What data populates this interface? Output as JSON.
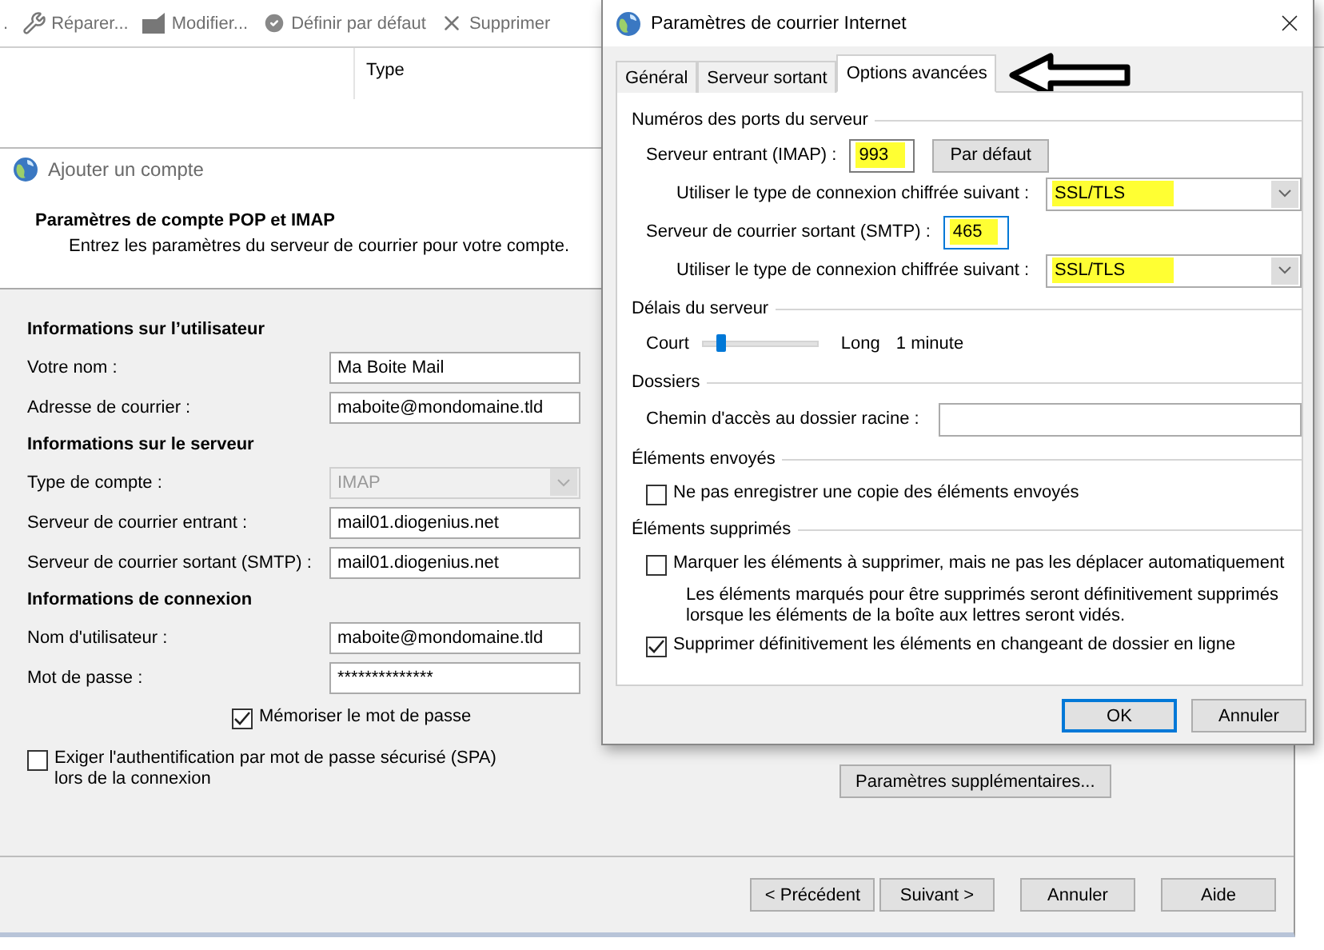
{
  "background_window": {
    "toolbar": [
      {
        "kind": "fragment",
        "label": ".",
        "disabled": true
      },
      {
        "kind": "repair",
        "label": "Réparer...",
        "disabled": true
      },
      {
        "kind": "modify",
        "label": "Modifier...",
        "disabled": true
      },
      {
        "kind": "set_default",
        "label": "Définir par défaut",
        "disabled": true
      },
      {
        "kind": "delete",
        "label": "Supprimer",
        "disabled": true
      }
    ],
    "list_columns": [
      "Type"
    ]
  },
  "add_account": {
    "title": "Ajouter un compte",
    "heading": "Paramètres de compte POP et IMAP",
    "subtitle": "Entrez les paramètres du serveur de courrier pour votre compte.",
    "sections": [
      {
        "title": "Informations sur l’utilisateur",
        "fields": [
          {
            "kind": "text",
            "label": "Votre nom :",
            "value": "Ma Boite Mail",
            "disabled": false
          },
          {
            "kind": "text",
            "label": "Adresse de courrier :",
            "value": "maboite@mondomaine.tld",
            "disabled": false
          }
        ]
      },
      {
        "title": "Informations sur le serveur",
        "fields": [
          {
            "kind": "select",
            "label": "Type de compte :",
            "value": "IMAP",
            "disabled": true
          },
          {
            "kind": "text",
            "label": "Serveur de courrier entrant :",
            "value": "mail01.diogenius.net",
            "disabled": false
          },
          {
            "kind": "text",
            "label": "Serveur de courrier sortant (SMTP) :",
            "value": "mail01.diogenius.net",
            "disabled": false
          }
        ]
      },
      {
        "title": "Informations de connexion",
        "fields": [
          {
            "kind": "text",
            "label": "Nom d'utilisateur :",
            "value": "maboite@mondomaine.tld",
            "disabled": false
          },
          {
            "kind": "text",
            "label": "Mot de passe :",
            "value": "**************",
            "disabled": false
          }
        ]
      }
    ],
    "remember_password": {
      "label": "Mémoriser le mot de passe",
      "checked": true
    },
    "spa": {
      "label_lines": [
        "Exiger l'authentification par mot de passe sécurisé (SPA)",
        "lors de la connexion"
      ],
      "checked": false
    },
    "more_settings_button": "Paramètres supplémentaires...",
    "footer_buttons": [
      "< Précédent",
      "Suivant >",
      "Annuler",
      "Aide"
    ]
  },
  "internet_settings": {
    "title": "Paramètres de courrier Internet",
    "tabs": [
      {
        "label": "Général",
        "selected": false
      },
      {
        "label": "Serveur sortant",
        "selected": false
      },
      {
        "label": "Options avancées",
        "selected": true
      }
    ],
    "groups": [
      {
        "title": "Numéros des ports du serveur",
        "items": [
          {
            "kind": "port",
            "label": "Serveur entrant (IMAP) :",
            "value": "993",
            "highlighted": true,
            "focused": false,
            "button": "Par défaut"
          },
          {
            "kind": "select",
            "label": "Utiliser le type de connexion chiffrée suivant :",
            "value": "SSL/TLS",
            "highlighted": true
          },
          {
            "kind": "port",
            "label": "Serveur de courrier sortant (SMTP) :",
            "value": "465",
            "highlighted": true,
            "focused": true
          },
          {
            "kind": "select",
            "label": "Utiliser le type de connexion chiffrée suivant :",
            "value": "SSL/TLS",
            "highlighted": true
          }
        ]
      },
      {
        "title": "Délais du serveur",
        "items": [
          {
            "kind": "slider",
            "min_label": "Court",
            "max_label": "Long",
            "level": 0.12,
            "reading": "1 minute"
          }
        ]
      },
      {
        "title": "Dossiers",
        "items": [
          {
            "kind": "text_field",
            "label": "Chemin d'accès au dossier racine :"
          }
        ]
      },
      {
        "title": "Éléments envoyés",
        "items": [
          {
            "kind": "checkbox",
            "label": "Ne pas enregistrer une copie des éléments envoyés",
            "checked": false
          }
        ]
      },
      {
        "title": "Éléments supprimés",
        "items": [
          {
            "kind": "checkbox",
            "label": "Marquer les éléments à supprimer, mais ne pas les déplacer automatiquement",
            "checked": false
          },
          {
            "kind": "note",
            "lines": [
              "Les éléments marqués pour être supprimés seront définitivement supprimés",
              "lorsque les éléments de la boîte aux lettres seront vidés."
            ]
          },
          {
            "kind": "checkbox",
            "label": "Supprimer définitivement les éléments en changeant de dossier en ligne",
            "checked": true
          }
        ]
      }
    ],
    "buttons": [
      {
        "label": "OK",
        "default": true
      },
      {
        "label": "Annuler",
        "default": false
      }
    ]
  }
}
